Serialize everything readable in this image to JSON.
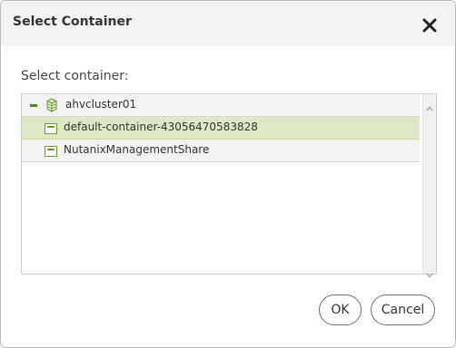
{
  "dialog": {
    "title": "Select Container",
    "close_icon": "close-x-icon",
    "prompt": "Select container:"
  },
  "tree": {
    "root": {
      "label": "ahvcluster01",
      "icon": "cluster-icon",
      "expanded": true
    },
    "items": [
      {
        "label": "default-container-43056470583828",
        "icon": "storage-container-icon",
        "selected": true
      },
      {
        "label": "NutanixManagementShare",
        "icon": "storage-container-icon",
        "selected": false
      }
    ]
  },
  "buttons": {
    "ok_label": "OK",
    "cancel_label": "Cancel"
  },
  "colors": {
    "accent_green": "#4a8a17",
    "selected_row": "#dde9c5",
    "header_bg": "#f3f3f3"
  }
}
